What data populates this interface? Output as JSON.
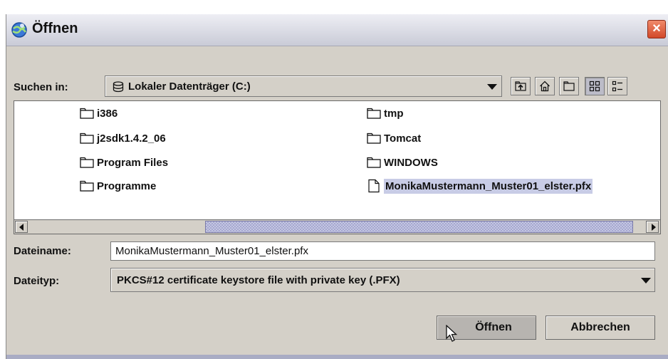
{
  "window": {
    "title": "Öffnen",
    "close_label": "×"
  },
  "look_in": {
    "label": "Suchen in:",
    "value": "Lokaler Datenträger (C:)"
  },
  "toolbar": {
    "buttons": [
      {
        "name": "up-one-level",
        "icon": "up-folder-icon"
      },
      {
        "name": "home",
        "icon": "home-icon"
      },
      {
        "name": "new-folder",
        "icon": "new-folder-icon"
      },
      {
        "name": "list-view",
        "icon": "list-view-icon",
        "active": true
      },
      {
        "name": "details-view",
        "icon": "details-view-icon",
        "active": false
      }
    ]
  },
  "files": {
    "column1": [
      "i386",
      "j2sdk1.4.2_06",
      "Program Files",
      "Programme"
    ],
    "column2": [
      "tmp",
      "Tomcat",
      "WINDOWS",
      "MonikaMustermann_Muster01_elster.pfx"
    ],
    "selected": "MonikaMustermann_Muster01_elster.pfx"
  },
  "filename": {
    "label": "Dateiname:",
    "value": "MonikaMustermann_Muster01_elster.pfx"
  },
  "filetype": {
    "label": "Dateityp:",
    "value": "PKCS#12 certificate keystore file with private key (.PFX)"
  },
  "buttons": {
    "open": "Öffnen",
    "cancel": "Abbrechen"
  },
  "colors": {
    "selection": "#c8cce6",
    "window_bg": "#d4d0c8",
    "close_button": "#d2492a"
  }
}
